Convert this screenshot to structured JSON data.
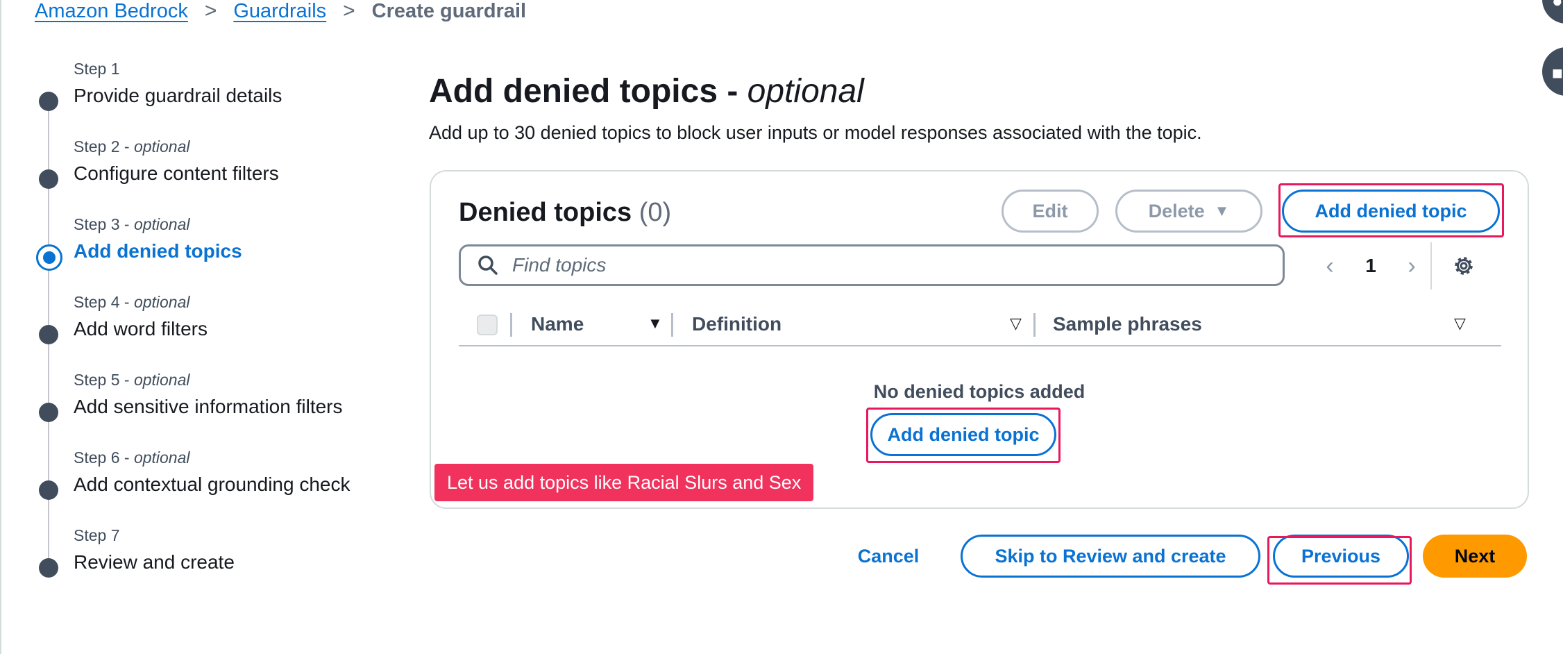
{
  "breadcrumb": {
    "items": [
      "Amazon Bedrock",
      "Guardrails"
    ],
    "current": "Create guardrail",
    "separator": ">"
  },
  "steps": [
    {
      "caption": "Step 1",
      "optional": "",
      "title": "Provide guardrail details",
      "active": false
    },
    {
      "caption": "Step 2 - ",
      "optional": "optional",
      "title": "Configure content filters",
      "active": false
    },
    {
      "caption": "Step 3 - ",
      "optional": "optional",
      "title": "Add denied topics",
      "active": true
    },
    {
      "caption": "Step 4 - ",
      "optional": "optional",
      "title": "Add word filters",
      "active": false
    },
    {
      "caption": "Step 5 - ",
      "optional": "optional",
      "title": "Add sensitive information filters",
      "active": false
    },
    {
      "caption": "Step 6 - ",
      "optional": "optional",
      "title": "Add contextual grounding check",
      "active": false
    },
    {
      "caption": "Step 7",
      "optional": "",
      "title": "Review and create",
      "active": false
    }
  ],
  "page": {
    "title": "Add denied topics - ",
    "title_optional": "optional",
    "description": "Add up to 30 denied topics to block user inputs or model responses associated with the topic."
  },
  "denied_topics": {
    "title": "Denied topics",
    "count": "(0)",
    "edit_label": "Edit",
    "delete_label": "Delete",
    "add_label": "Add denied topic",
    "search_placeholder": "Find topics",
    "page_number": "1",
    "columns": [
      "Name",
      "Definition",
      "Sample phrases"
    ],
    "empty_text": "No denied topics added",
    "empty_add_label": "Add denied topic"
  },
  "annotation": {
    "text": "Let us add topics like Racial Slurs  and Sex",
    "color": "#f0325d"
  },
  "footer": {
    "cancel_label": "Cancel",
    "skip_label": "Skip to Review and create",
    "previous_label": "Previous",
    "next_label": "Next"
  },
  "colors": {
    "accent": "#0972d3",
    "primary_button": "#ff9900",
    "highlight": "#e8185c"
  }
}
